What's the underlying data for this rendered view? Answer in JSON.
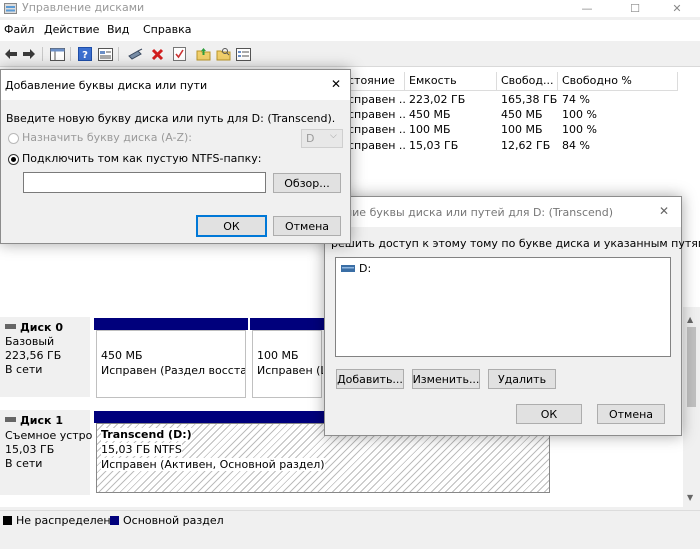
{
  "app": {
    "title": "Управление дисками",
    "controls": {
      "minimize": "—",
      "maximize": "☐",
      "close": "✕"
    }
  },
  "menu": [
    "Файл",
    "Действие",
    "Вид",
    "Справка"
  ],
  "toolbar": {
    "icons": [
      "back-icon",
      "forward-icon",
      "console-tree-icon",
      "help-icon",
      "properties-icon",
      "connect-icon",
      "delete-icon",
      "check-icon",
      "folder-up-icon",
      "folder-search-icon",
      "list-icon"
    ]
  },
  "volume_table": {
    "headers": [
      "стояние",
      "Емкость",
      "Свобод...",
      "Свободно %"
    ],
    "rows": [
      {
        "status": "справен ...",
        "capacity": "223,02 ГБ",
        "free": "165,38 ГБ",
        "free_pct": "74 %"
      },
      {
        "status": "справен ...",
        "capacity": "450 МБ",
        "free": "450 МБ",
        "free_pct": "100 %"
      },
      {
        "status": "справен ...",
        "capacity": "100 МБ",
        "free": "100 МБ",
        "free_pct": "100 %"
      },
      {
        "status": "справен ...",
        "capacity": "15,03 ГБ",
        "free": "12,62 ГБ",
        "free_pct": "84 %"
      }
    ]
  },
  "disks": [
    {
      "name": "Диск 0",
      "type": "Базовый",
      "size": "223,56 ГБ",
      "status": "В сети",
      "partitions": [
        {
          "size": "450 МБ",
          "status": "Исправен (Раздел восстанс"
        },
        {
          "size": "100 МБ",
          "status": "Исправен (Ш"
        }
      ]
    },
    {
      "name": "Диск 1",
      "type": "Съемное устро",
      "size": "15,03 ГБ",
      "status": "В сети",
      "partitions": [
        {
          "name": "Transcend  (D:)",
          "size": "15,03 ГБ NTFS",
          "status": "Исправен (Активен, Основной раздел)"
        }
      ]
    }
  ],
  "legend": [
    {
      "label": "Не распределена",
      "color": "#000000"
    },
    {
      "label": "Основной раздел",
      "color": "#00007c"
    }
  ],
  "dialog_add": {
    "title": "Добавление буквы диска или пути",
    "prompt": "Введите новую букву диска или путь для D: (Transcend).",
    "option_letter": "Назначить букву диска (A-Z):",
    "letter_value": "D",
    "option_folder": "Подключить том как пустую NTFS-папку:",
    "path_value": "",
    "browse": "Обзор...",
    "ok": "ОК",
    "cancel": "Отмена"
  },
  "dialog_change": {
    "title": "нение буквы диска или путей для D: (Transcend)",
    "description": "решить доступ к этому тому по букве диска и указанным путям.",
    "entries": [
      "D:"
    ],
    "add": "Добавить...",
    "change": "Изменить...",
    "remove": "Удалить",
    "ok": "ОК",
    "cancel": "Отмена"
  }
}
